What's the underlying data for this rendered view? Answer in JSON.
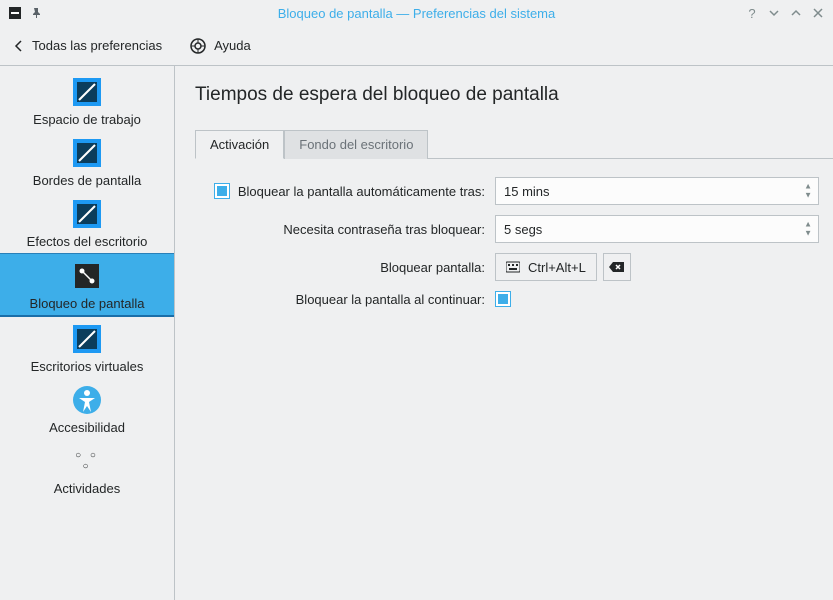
{
  "titlebar": {
    "title": "Bloqueo de pantalla — Preferencias del sistema"
  },
  "toolbar": {
    "back_label": "Todas las preferencias",
    "help_label": "Ayuda"
  },
  "sidebar": {
    "items": [
      {
        "label": "Espacio de trabajo"
      },
      {
        "label": "Bordes de pantalla"
      },
      {
        "label": "Efectos del escritorio"
      },
      {
        "label": "Bloqueo de pantalla"
      },
      {
        "label": "Escritorios virtuales"
      },
      {
        "label": "Accesibilidad"
      },
      {
        "label": "Actividades"
      }
    ],
    "selected_index": 3
  },
  "main": {
    "title": "Tiempos de espera del bloqueo de pantalla",
    "tabs": [
      {
        "label": "Activación"
      },
      {
        "label": "Fondo del escritorio"
      }
    ],
    "active_tab_index": 0,
    "form": {
      "auto_lock_label": "Bloquear la pantalla automáticamente tras:",
      "auto_lock_value": "15 mins",
      "auto_lock_checked": true,
      "password_after_label": "Necesita contraseña tras bloquear:",
      "password_after_value": "5 segs",
      "shortcut_label": "Bloquear pantalla:",
      "shortcut_value": "Ctrl+Alt+L",
      "lock_resume_label": "Bloquear la pantalla al continuar:",
      "lock_resume_checked": true
    }
  }
}
